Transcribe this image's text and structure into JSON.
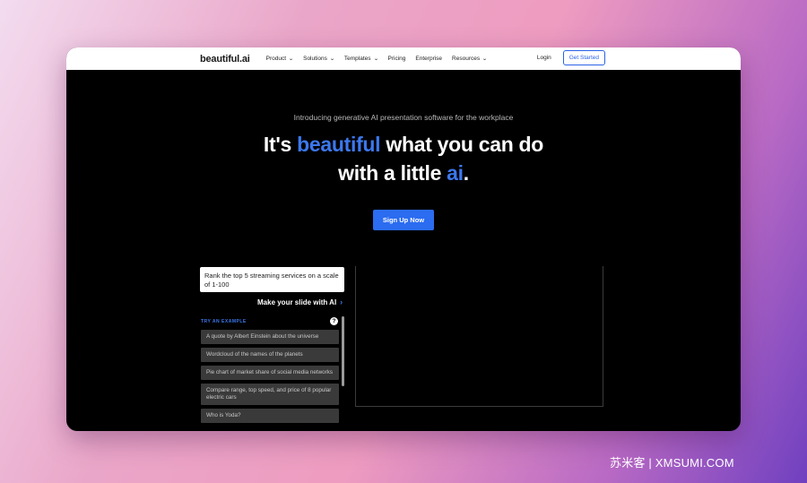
{
  "nav": {
    "logo": "beautiful.ai",
    "items": [
      {
        "label": "Product",
        "dropdown": true
      },
      {
        "label": "Solutions",
        "dropdown": true
      },
      {
        "label": "Templates",
        "dropdown": true
      },
      {
        "label": "Pricing",
        "dropdown": false
      },
      {
        "label": "Enterprise",
        "dropdown": false
      },
      {
        "label": "Resources",
        "dropdown": true
      }
    ],
    "login": "Login",
    "get_started": "Get Started"
  },
  "hero": {
    "intro": "Introducing generative AI presentation software for the workplace",
    "line1_a": "It's",
    "line1_blue": "beautiful",
    "line1_b": "what you can do",
    "line2_a": "with a little",
    "line2_blue": "ai",
    "line2_b": ".",
    "signup": "Sign Up Now"
  },
  "maker": {
    "prompt": "Rank the top 5 streaming services on a scale of 1-100",
    "make_slide": "Make your slide with AI",
    "try_label": "TRY AN EXAMPLE",
    "examples": [
      "A quote by Albert Einstein about the universe",
      "Wordcloud of the names of the planets",
      "Pie chart of market share of social media networks",
      "Compare range, top speed, and price of 8 popular electric cars",
      "Who is Yoda?"
    ]
  },
  "watermark": "苏米客 | XMSUMI.COM",
  "colors": {
    "accent": "#2b6cf0",
    "headline_blue": "#3c78ee"
  }
}
